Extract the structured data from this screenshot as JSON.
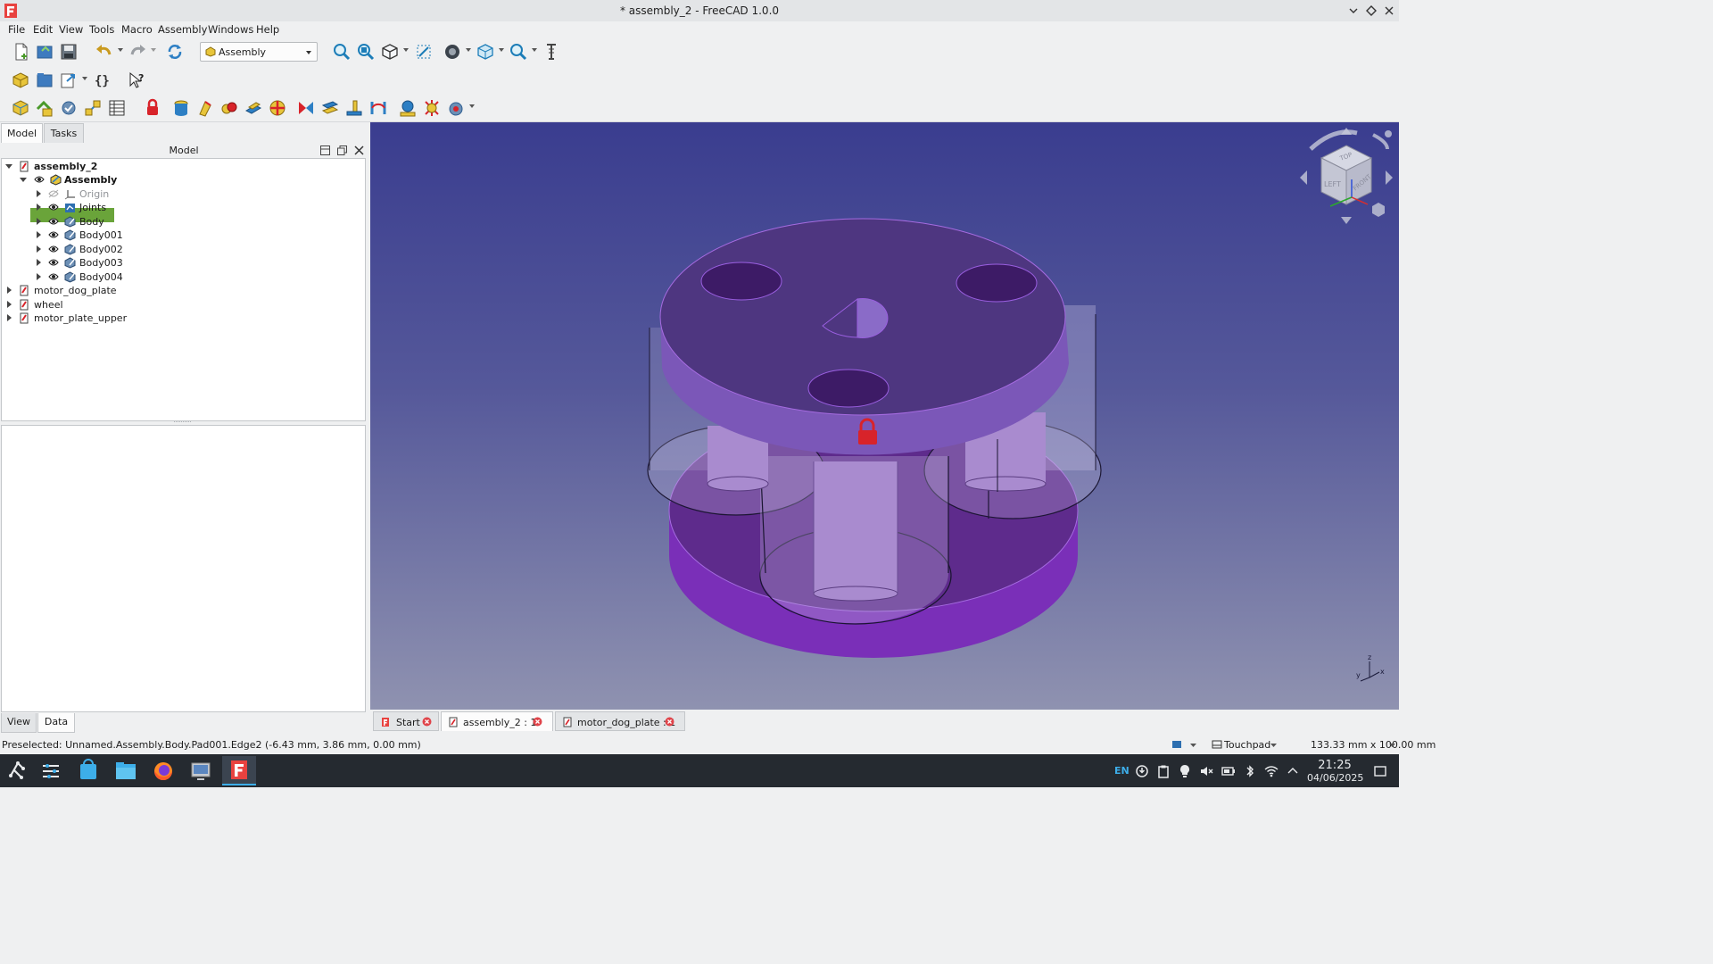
{
  "window": {
    "title": "* assembly_2 - FreeCAD 1.0.0",
    "logo_letter": "F",
    "controls": [
      "minimize-icon",
      "maximize-icon",
      "close-icon"
    ]
  },
  "menu": [
    "File",
    "Edit",
    "View",
    "Tools",
    "Macro",
    "Assembly",
    "Windows",
    "Help"
  ],
  "toolbar": {
    "workbench": "Assembly"
  },
  "left_panel": {
    "tabs": [
      "Model",
      "Tasks"
    ],
    "header_title": "Model",
    "tree": [
      {
        "label": "assembly_2",
        "level": 0,
        "expanded": true,
        "bold": true
      },
      {
        "label": "Assembly",
        "level": 1,
        "expanded": true,
        "bold": true,
        "selected": true
      },
      {
        "label": "Origin",
        "level": 2,
        "muted": true
      },
      {
        "label": "Joints",
        "level": 2
      },
      {
        "label": "Body",
        "level": 2
      },
      {
        "label": "Body001",
        "level": 2
      },
      {
        "label": "Body002",
        "level": 2
      },
      {
        "label": "Body003",
        "level": 2
      },
      {
        "label": "Body004",
        "level": 2
      },
      {
        "label": "motor_dog_plate",
        "level": 0
      },
      {
        "label": "wheel",
        "level": 0
      },
      {
        "label": "motor_plate_upper",
        "level": 0
      }
    ],
    "bottom_tabs": [
      "View",
      "Data"
    ]
  },
  "navcube": {
    "faces": {
      "top": "TOP",
      "left": "LEFT",
      "front": "FRONT"
    }
  },
  "axis": {
    "x": "x",
    "y": "y",
    "z": "z"
  },
  "doc_tabs": [
    {
      "label": "Start",
      "active": false
    },
    {
      "label": "assembly_2 : 1*",
      "active": true
    },
    {
      "label": "motor_dog_plate : 1",
      "active": false
    }
  ],
  "status": {
    "preselected": "Preselected: Unnamed.Assembly.Body.Pad001.Edge2 (-6.43 mm, 3.86 mm, 0.00 mm)",
    "navigation": "Touchpad",
    "dimensions": "133.33 mm x 100.00 mm"
  },
  "taskbar": {
    "lang": "EN",
    "time": "21:25",
    "date": "04/06/2025"
  },
  "colors": {
    "accent": "#3daee9",
    "selection": "#6aa43a",
    "part_purple": "#8a4fd0",
    "viewport_top": "#3a3d8f",
    "viewport_bottom": "#8f92b0"
  }
}
